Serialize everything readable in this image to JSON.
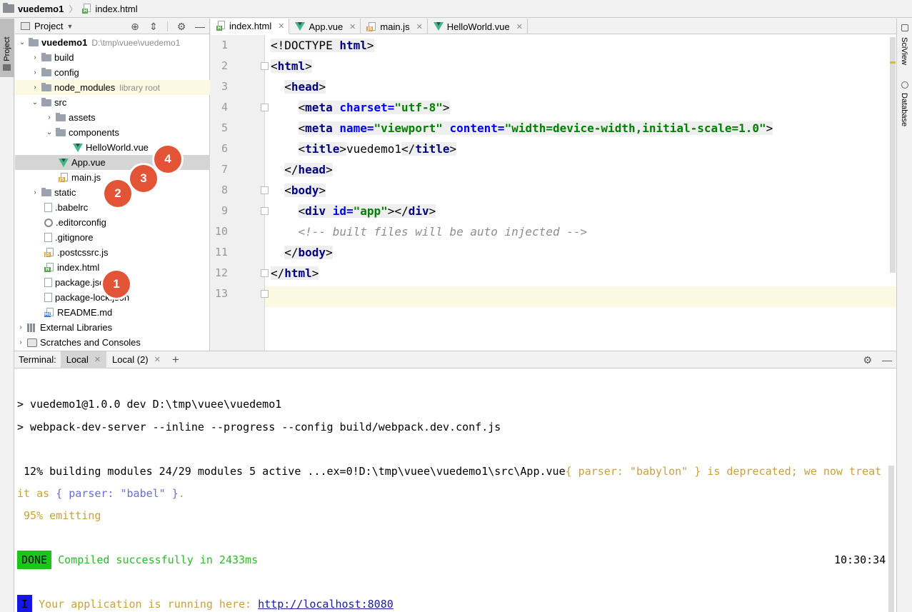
{
  "breadcrumb": {
    "project": "vuedemo1",
    "file": "index.html"
  },
  "left_strip": {
    "tab_label": "1: Project"
  },
  "right_strip": {
    "sciview": "SciView",
    "database": "Database"
  },
  "project_panel": {
    "header": "Project",
    "tree": [
      {
        "label": "vuedemo1",
        "hint": "D:\\tmp\\vuee\\vuedemo1",
        "icon": "folder"
      },
      {
        "label": "build",
        "icon": "folder"
      },
      {
        "label": "config",
        "icon": "folder"
      },
      {
        "label": "node_modules",
        "hint": "library root",
        "icon": "folder"
      },
      {
        "label": "src",
        "icon": "folder"
      },
      {
        "label": "assets",
        "icon": "folder"
      },
      {
        "label": "components",
        "icon": "folder"
      },
      {
        "label": "HelloWorld.vue",
        "icon": "vue"
      },
      {
        "label": "App.vue",
        "icon": "vue"
      },
      {
        "label": "main.js",
        "icon": "js"
      },
      {
        "label": "static",
        "icon": "folder"
      },
      {
        "label": ".babelrc",
        "icon": "config"
      },
      {
        "label": ".editorconfig",
        "icon": "gear"
      },
      {
        "label": ".gitignore",
        "icon": "text"
      },
      {
        "label": ".postcssrc.js",
        "icon": "js"
      },
      {
        "label": "index.html",
        "icon": "html"
      },
      {
        "label": "package.json",
        "icon": "config"
      },
      {
        "label": "package-lock.json",
        "icon": "config"
      },
      {
        "label": "README.md",
        "icon": "md"
      },
      {
        "label": "External Libraries",
        "icon": "libraries"
      },
      {
        "label": "Scratches and Consoles",
        "icon": "scratch"
      }
    ],
    "markers": [
      "1",
      "2",
      "3",
      "4"
    ]
  },
  "editor": {
    "tabs": [
      {
        "label": "index.html",
        "active": true
      },
      {
        "label": "App.vue",
        "active": false
      },
      {
        "label": "main.js",
        "active": false
      },
      {
        "label": "HelloWorld.vue",
        "active": false
      }
    ],
    "line_numbers": [
      "1",
      "2",
      "3",
      "4",
      "5",
      "6",
      "7",
      "8",
      "9",
      "10",
      "11",
      "12",
      "13"
    ],
    "code": {
      "doctype": "<!DOCTYPE",
      "doctype_html": "html",
      "html_tag": "html",
      "head_tag": "head",
      "meta_tag": "meta",
      "charset_attr": "charset",
      "charset_val": "\"utf-8\"",
      "name_attr": "name",
      "name_val": "\"viewport\"",
      "content_attr": "content",
      "content_val": "\"width=device-width,initial-scale=1.0\"",
      "title_tag": "title",
      "title_text": "vuedemo1",
      "body_tag": "body",
      "div_tag": "div",
      "id_attr": "id",
      "id_val": "\"app\"",
      "comment": "<!-- built files will be auto injected -->"
    }
  },
  "terminal": {
    "title": "Terminal:",
    "tabs": [
      {
        "label": "Local",
        "active": true
      },
      {
        "label": "Local (2)",
        "active": false
      }
    ],
    "lines": {
      "l1": "> vuedemo1@1.0.0 dev D:\\tmp\\vuee\\vuedemo1",
      "l2": "> webpack-dev-server --inline --progress --config build/webpack.dev.conf.js",
      "l3_main": " 12% building modules 24/29 modules 5 active ...ex=0!D:\\tmp\\vuee\\vuedemo1\\src\\App.vue",
      "l3_warn": "{ parser: \"babylon\" } is deprecated; we now treat",
      "l4_start": "it as ",
      "l4_mid": "{ parser: \"babel\" }",
      "l4_end": ".",
      "l5": " 95% emitting",
      "done_badge": "DONE",
      "done_msg": "Compiled successfully in 2433ms",
      "timestamp": "10:30:34",
      "info_badge": "I",
      "running_msg": "Your application is running here: ",
      "url": "http://localhost:8080"
    }
  },
  "colors": {
    "accent_vue": "#41b883",
    "marker": "#e25435",
    "tag": "#000080",
    "attr": "#0000ff",
    "value": "#008000",
    "done_bg": "#19c619",
    "info_bg": "#1515e6"
  }
}
